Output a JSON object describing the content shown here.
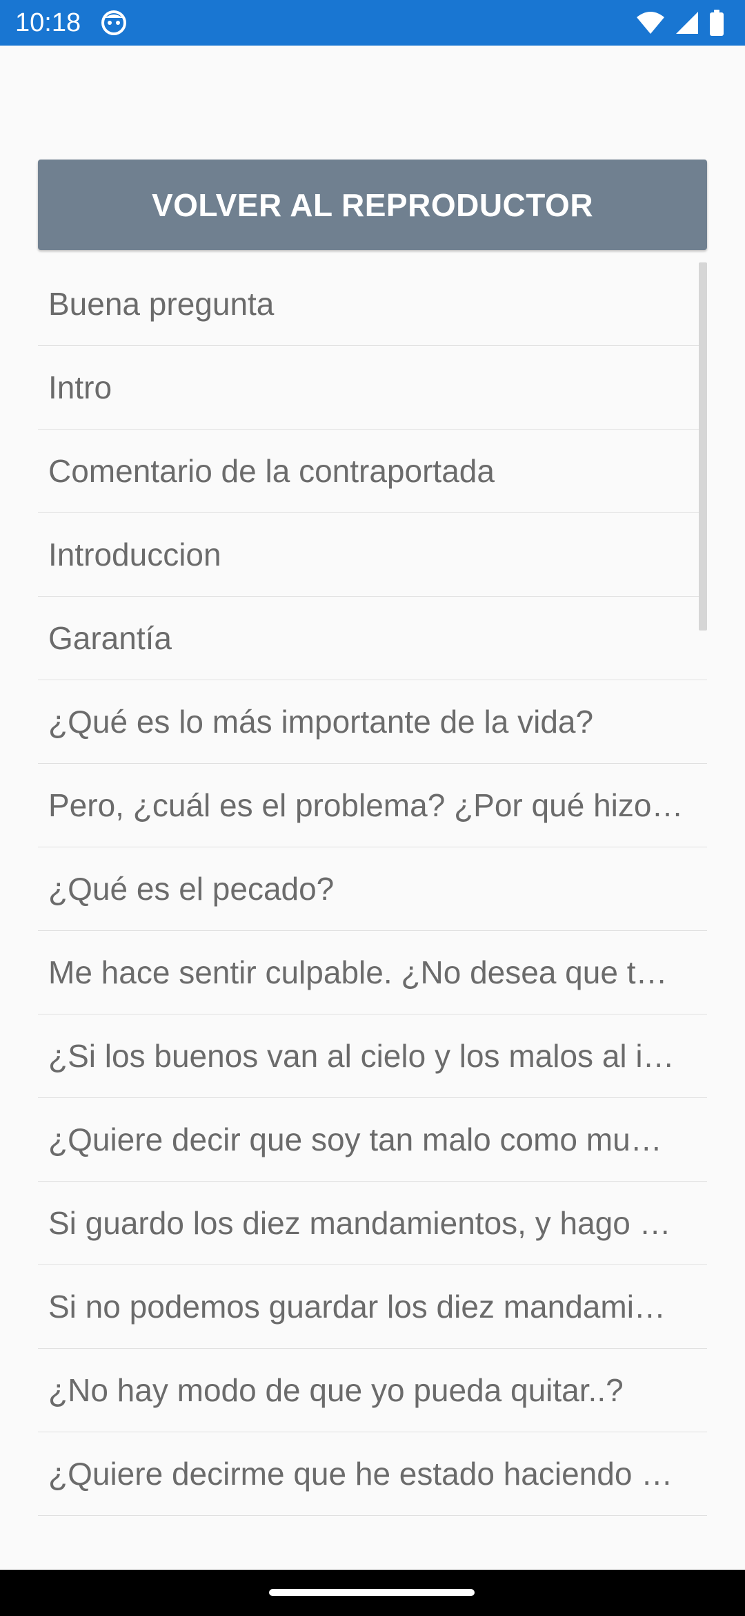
{
  "status_bar": {
    "time": "10:18",
    "app_icon": "face-icon",
    "icons": [
      "wifi-icon",
      "signal-icon",
      "battery-icon"
    ],
    "background_color": "#1976d2"
  },
  "return_button": {
    "label": "VOLVER AL REPRODUCTOR",
    "background_color": "#708090"
  },
  "chapters": [
    "Buena pregunta",
    "Intro",
    "Comentario de la contraportada",
    "Introduccion",
    "Garantía",
    "¿Qué es lo más importante de la vida?",
    "Pero, ¿cuál es el problema? ¿Por qué hizo…",
    "¿Qué es el pecado?",
    "Me hace sentir culpable. ¿No desea que t…",
    "¿Si los buenos van al cielo y los malos al i…",
    "¿Quiere decir que soy tan malo como mu…",
    "Si guardo los diez mandamientos, y hago …",
    "Si no podemos guardar los diez mandami…",
    "¿No hay modo de que yo pueda quitar..?",
    "¿Quiere decirme que he estado haciendo …"
  ]
}
